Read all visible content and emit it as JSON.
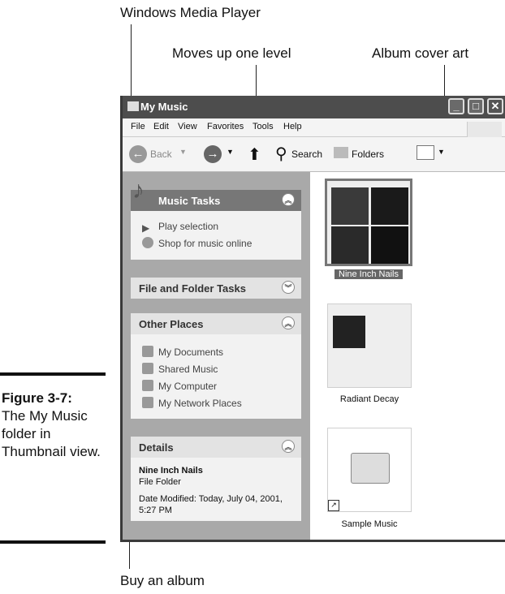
{
  "callouts": {
    "media_player": "Windows Media Player",
    "up_level": "Moves up one level",
    "album_art": "Album cover art",
    "buy_album": "Buy an album"
  },
  "caption": {
    "fig_label": "Figure 3-7:",
    "text": "The My Music folder in Thumbnail view."
  },
  "window": {
    "title": "My Music",
    "menus": [
      "File",
      "Edit",
      "View",
      "Favorites",
      "Tools",
      "Help"
    ],
    "toolbar": {
      "back": "Back",
      "search": "Search",
      "folders": "Folders"
    }
  },
  "tasks": {
    "music": {
      "title": "Music Tasks",
      "items": [
        "Play selection",
        "Shop for music online"
      ]
    },
    "file_folder": {
      "title": "File and Folder Tasks"
    },
    "other": {
      "title": "Other Places",
      "items": [
        "My Documents",
        "Shared Music",
        "My Computer",
        "My Network Places"
      ]
    },
    "details": {
      "title": "Details",
      "name": "Nine Inch Nails",
      "type": "File Folder",
      "modified": "Date Modified: Today, July 04, 2001, 5:27 PM"
    }
  },
  "folders": [
    {
      "label": "Nine Inch Nails"
    },
    {
      "label": "Radiant Decay"
    },
    {
      "label": "Sample Music"
    }
  ]
}
